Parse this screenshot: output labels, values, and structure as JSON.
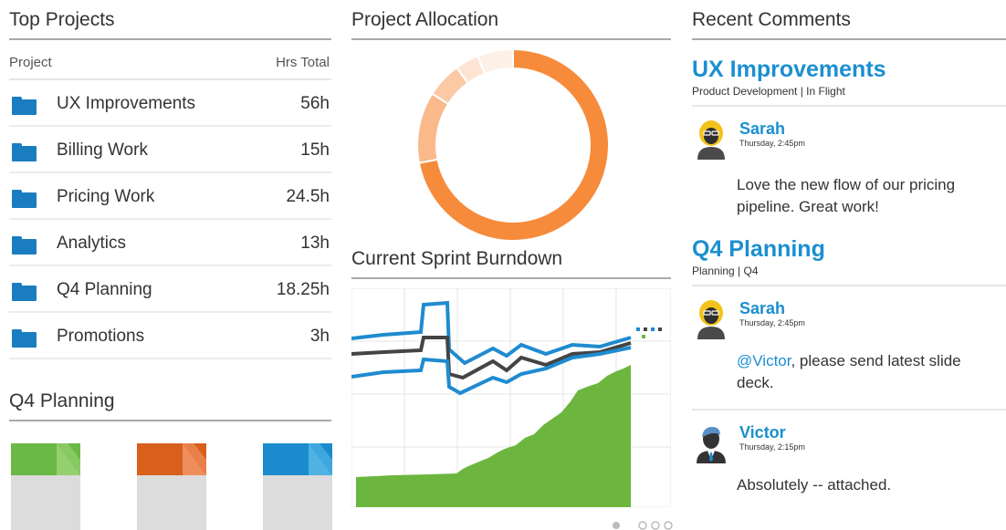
{
  "top_projects": {
    "title": "Top Projects",
    "col_project": "Project",
    "col_hours": "Hrs Total",
    "rows": [
      {
        "name": "UX Improvements",
        "hours": "56h"
      },
      {
        "name": "Billing Work",
        "hours": "15h"
      },
      {
        "name": "Pricing Work",
        "hours": "24.5h"
      },
      {
        "name": "Analytics",
        "hours": "13h"
      },
      {
        "name": "Q4 Planning",
        "hours": "18.25h"
      },
      {
        "name": "Promotions",
        "hours": "3h"
      }
    ],
    "folder_color": "#1a7dc0"
  },
  "q4_planning": {
    "title": "Q4 Planning",
    "documents": [
      {
        "icon": "document-icon",
        "color": "#6ab845",
        "fold": "#95d070"
      },
      {
        "icon": "document-icon",
        "color": "#d95f1d",
        "fold": "#ef8e5c"
      },
      {
        "icon": "document-icon",
        "color": "#1a8ccd",
        "fold": "#4fb2e3"
      }
    ]
  },
  "allocation": {
    "title": "Project Allocation",
    "slices": [
      {
        "value": 72,
        "color": "#f68b3b"
      },
      {
        "value": 12,
        "color": "#f9b98a"
      },
      {
        "value": 6,
        "color": "#fbcaa5"
      },
      {
        "value": 4,
        "color": "#fde4d2"
      },
      {
        "value": 6,
        "color": "#fdf0e7"
      }
    ]
  },
  "burndown": {
    "title": "Current Sprint Burndown",
    "colors": {
      "band": "#1f8bd0",
      "mid": "#444444",
      "area": "#6cb63f",
      "grid": "#e4e4e4"
    }
  },
  "recent_comments": {
    "title": "Recent Comments",
    "groups": [
      {
        "project": "UX Improvements",
        "meta": "Product Development | In Flight",
        "comments": [
          {
            "author": "Sarah",
            "time": "Thursday, 2:45pm",
            "text": "Love the new flow of our pricing pipeline. Great work!",
            "avatar": "woman-avatar-icon"
          }
        ]
      },
      {
        "project": "Q4 Planning",
        "meta": "Planning | Q4",
        "comments": [
          {
            "author": "Sarah",
            "time": "Thursday, 2:45pm",
            "mention": "@Victor",
            "text": ", please send latest slide deck.",
            "avatar": "woman-avatar-icon"
          },
          {
            "author": "Victor",
            "time": "Thursday, 2:15pm",
            "text": "Absolutely -- attached.",
            "avatar": "man-avatar-icon"
          }
        ]
      }
    ]
  }
}
